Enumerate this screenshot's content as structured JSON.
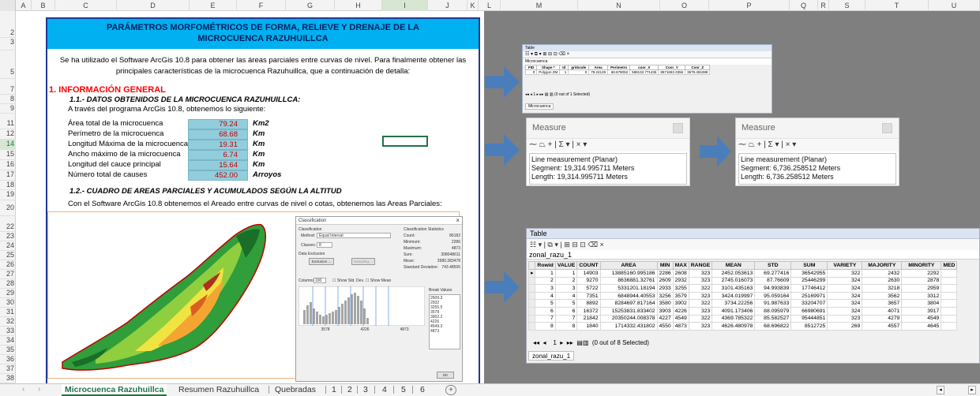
{
  "columns": [
    "A",
    "B",
    "C",
    "D",
    "E",
    "F",
    "G",
    "H",
    "I",
    "J",
    "K",
    "L",
    "M",
    "N",
    "O",
    "P",
    "Q",
    "R",
    "S",
    "T",
    "U"
  ],
  "rows": [
    "2",
    "3",
    "5",
    "7",
    "8",
    "9",
    "11",
    "12",
    "14",
    "15",
    "16",
    "17",
    "18",
    "19",
    "20",
    "22",
    "23",
    "24",
    "25",
    "26",
    "27",
    "28",
    "29",
    "30",
    "31",
    "32",
    "33",
    "34",
    "35",
    "36",
    "37",
    "38"
  ],
  "doc": {
    "title_line1": "PARÁMETROS MORFOMÉTRICOS DE FORMA, RELIEVE Y DRENAJE DE LA",
    "title_line2": "MICROCUENCA RAZUHUILLCA",
    "intro_line1": "Se ha utilizado el Software ArcGis 10.8  para obtener las áreas parciales entre curvas de nivel. Para finalmente obtener las",
    "intro_line2": "principales características de la microcuenca Razuhuillca, que a continuación de detalla:",
    "section1": "1. INFORMACIÓN GENERAL",
    "sub1": "1.1.- DATOS OBTENIDOS DE LA MICROCUENCA RAZUHUILLCA:",
    "sub1_text": "A través del programa ArcGis 10.8, obtenemos lo siguiente:",
    "params": [
      {
        "label": "Área total de la microcuenca",
        "value": "79.24",
        "unit": "Km2"
      },
      {
        "label": "Perímetro de la microcuenca",
        "value": "68.68",
        "unit": "Km"
      },
      {
        "label": "Longitud Máxima de la microcuenca",
        "value": "19.31",
        "unit": "Km"
      },
      {
        "label": "Ancho máximo de la microcuenca",
        "value": "6.74",
        "unit": "Km"
      },
      {
        "label": "Longitud del cauce principal",
        "value": "15.64",
        "unit": "Km"
      },
      {
        "label": "Número total de causes",
        "value": "452.00",
        "unit": "Arroyos"
      }
    ],
    "sub2": "1.2.- CUADRO DE AREAS PARCIALES Y ACUMULADOS SEGÚN LA ALTITUD",
    "sub2_text": "Con el Software ArcGis 10.8 obtenemos el Areado entre curvas de nivel o cotas, obtenemos las Areas Parciales:"
  },
  "classify": {
    "title": "Classification",
    "close": "×",
    "method_label": "Method:",
    "method_value": "Equal Interval",
    "classes_label": "Classes:",
    "classes_value": "8",
    "exclusion": "Data Exclusion",
    "exclusion_btn": "Exclusion ...",
    "sampling_btn": "Sampling ...",
    "stats_title": "Classification Statistics",
    "stats": [
      {
        "k": "Count:",
        "v": "86182"
      },
      {
        "k": "Minimum:",
        "v": "2286"
      },
      {
        "k": "Maximum:",
        "v": "4873"
      },
      {
        "k": "Sum:",
        "v": "308048611"
      },
      {
        "k": "Mean:",
        "v": "3580.383478"
      },
      {
        "k": "Standard Deviation:",
        "v": "743.48595"
      }
    ],
    "columns_label": "Columns:",
    "columns_value": "100",
    "show_std": "Show Std. Dev.",
    "show_mean": "Show Mean",
    "break_title": "Break Values",
    "breaks": [
      "2609.3",
      "2932",
      "3255.5",
      "3578",
      "3902.2",
      "4226",
      "4549.3",
      "4873"
    ],
    "axis": [
      "3578",
      "4226",
      "4873"
    ],
    "ok": "OK"
  },
  "mini_table": {
    "title": "Table",
    "layer": "Microcuenca",
    "headers": [
      "FID",
      "Shape *",
      "Id",
      "gridcode",
      "Area",
      "Perimetro",
      "coor_X",
      "Coor_Y",
      "Coor_Z"
    ],
    "row": [
      "0",
      "Polygon ZM",
      "1",
      "0",
      "79.24129",
      "68.679052",
      "588132.771436",
      "8571653.3356",
      "3679.491088"
    ],
    "status": "(0 out of 1 Selected)",
    "nav": "1",
    "tab": "Microcuenca"
  },
  "measure1": {
    "title": "Measure",
    "tools": "⁓ ⏢ + | Σ ▾ | × ▾",
    "line1": "Line measurement (Planar)",
    "line2": "Segment: 19,314.995711 Meters",
    "line3": "Length: 19,314.995711 Meters"
  },
  "measure2": {
    "title": "Measure",
    "tools": "⁓ ⏢ + | Σ ▾ | × ▾",
    "line1": "Line measurement (Planar)",
    "line2": "Segment: 6,736.258512 Meters",
    "line3": "Length: 6,736.258512 Meters"
  },
  "zonal": {
    "title": "Table",
    "toolbar": "☷ ▾ | ⧉ ▾ | ⊞ ⊟ ⊡ ⌫ ×",
    "layer": "zonal_razu_1",
    "headers": [
      "",
      "Rowid",
      "VALUE",
      "COUNT",
      "AREA",
      "MIN",
      "MAX",
      "RANGE",
      "MEAN",
      "STD",
      "SUM",
      "VARIETY",
      "MAJORITY",
      "MINORITY",
      "MED"
    ],
    "rows": [
      [
        "▸",
        "1",
        "1",
        "14903",
        "13885160.995186",
        "2286",
        "2608",
        "323",
        "2452.053613",
        "69.277416",
        "36542955",
        "322",
        "2432",
        "2292",
        ""
      ],
      [
        "",
        "2",
        "2",
        "9270",
        "8636881.32761",
        "2609",
        "2932",
        "323",
        "2745.016073",
        "87.76609",
        "25446299",
        "324",
        "2630",
        "2878",
        ""
      ],
      [
        "",
        "3",
        "3",
        "5722",
        "5331201.18194",
        "2933",
        "3255",
        "322",
        "3101.435163",
        "94.993839",
        "17746412",
        "324",
        "3218",
        "2959",
        ""
      ],
      [
        "",
        "4",
        "4",
        "7351",
        "6848944.40553",
        "3256",
        "3579",
        "323",
        "3424.019997",
        "95.059164",
        "25169971",
        "324",
        "3562",
        "3312",
        ""
      ],
      [
        "",
        "5",
        "5",
        "8892",
        "8284697.817164",
        "3580",
        "3902",
        "322",
        "3734.22256",
        "91.987633",
        "33204707",
        "324",
        "3657",
        "3804",
        ""
      ],
      [
        "",
        "6",
        "6",
        "16372",
        "15253831.833402",
        "3903",
        "4226",
        "323",
        "4091.173406",
        "88.095979",
        "66980691",
        "324",
        "4071",
        "3917",
        ""
      ],
      [
        "",
        "7",
        "7",
        "21842",
        "20350244.008378",
        "4227",
        "4549",
        "322",
        "4369.785322",
        "85.582527",
        "95444851",
        "323",
        "4279",
        "4549",
        ""
      ],
      [
        "",
        "8",
        "8",
        "1840",
        "1714332.431802",
        "4550",
        "4873",
        "323",
        "4626.480978",
        "68.696822",
        "8512725",
        "269",
        "4557",
        "4645",
        ""
      ]
    ],
    "nav_first": "◂◂",
    "nav_prev": "◂",
    "nav_num": "1",
    "nav_next": "▸",
    "nav_last": "▸▸",
    "status": "(0 out of 8 Selected)",
    "tab": "zonal_razu_1"
  },
  "sheet_tabs": [
    "Microcuenca Razuhuillca",
    "Resumen Razuhuillca",
    "Quebradas",
    "1",
    "2",
    "3",
    "4",
    "5",
    "6"
  ],
  "add_sheet": "+",
  "colors": {
    "title_band": "#00b0f0",
    "title_text": "#002060",
    "value_fill": "#92cddc",
    "value_text": "#c00000",
    "heading": "#ff0000",
    "excel_green": "#217346",
    "arrow": "#4a7ebb"
  }
}
